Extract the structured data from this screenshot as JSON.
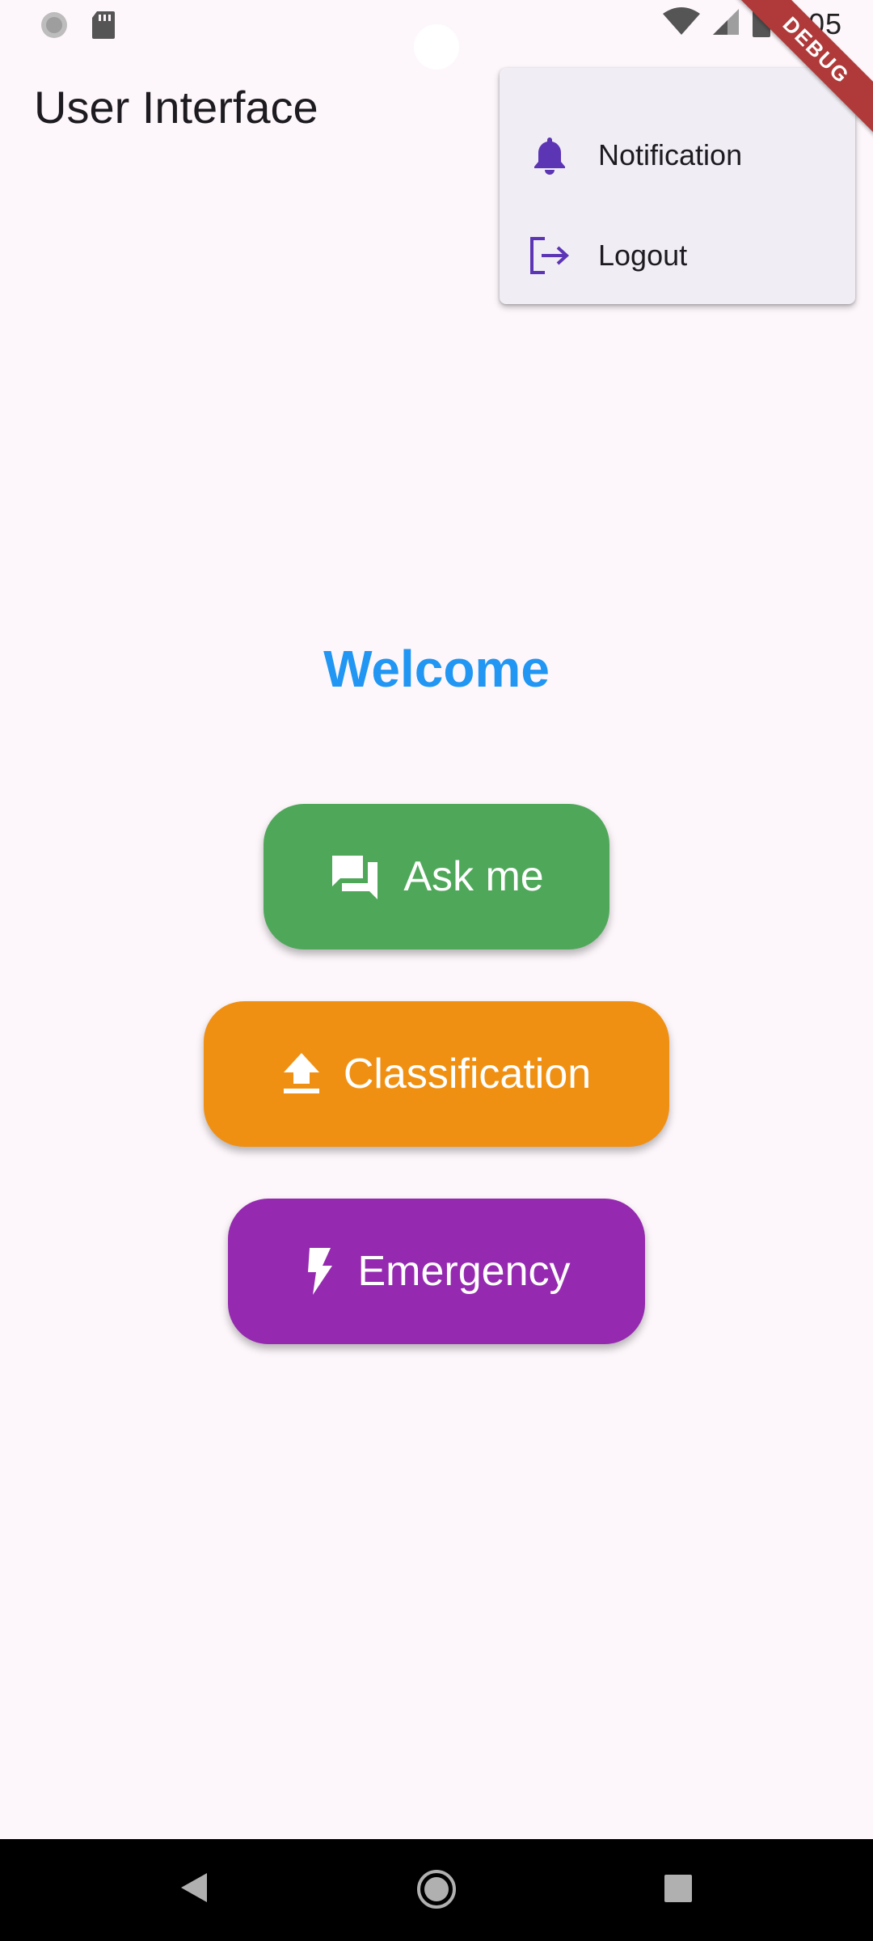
{
  "status_bar": {
    "time": "8:05",
    "icons": [
      "spinner-icon",
      "sd-card-icon",
      "wifi-icon",
      "cellular-signal-icon",
      "battery-icon"
    ]
  },
  "app_bar": {
    "title": "User Interface"
  },
  "debug_banner": {
    "label": "DEBUG"
  },
  "popup_menu": {
    "items": [
      {
        "label": "Notification",
        "icon": "bell-icon"
      },
      {
        "label": "Logout",
        "icon": "logout-icon"
      }
    ]
  },
  "main": {
    "welcome": "Welcome",
    "buttons": [
      {
        "label": "Ask me",
        "icon": "chat-bubbles-icon",
        "color": "#4fa85a"
      },
      {
        "label": "Classification",
        "icon": "upload-icon",
        "color": "#f09013"
      },
      {
        "label": "Emergency",
        "icon": "flash-icon",
        "color": "#9529b0"
      }
    ]
  },
  "colors": {
    "accent": "#2196f3",
    "menu_icon": "#5c35b5",
    "background": "#fdf7fb"
  },
  "nav_bar": {
    "buttons": [
      "back-icon",
      "home-icon",
      "recents-icon"
    ]
  }
}
